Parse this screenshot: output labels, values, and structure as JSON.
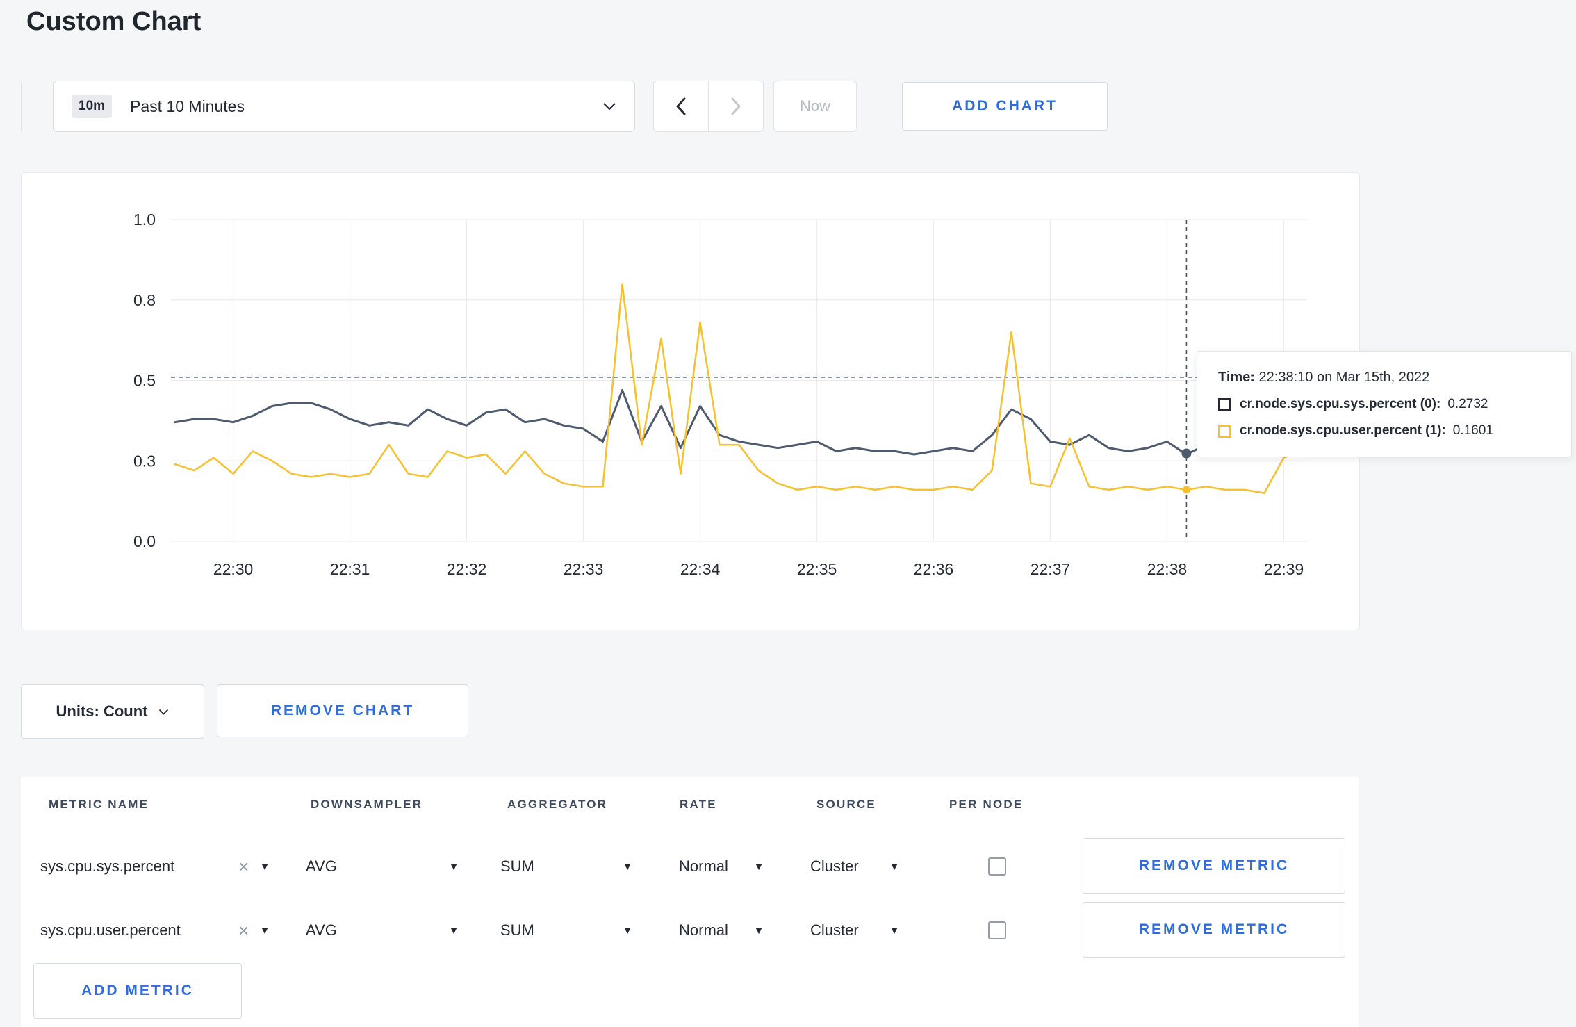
{
  "page": {
    "title": "Custom Chart"
  },
  "icons": {
    "caret_down": "▼",
    "close": "×"
  },
  "toolbar": {
    "time_range": {
      "badge": "10m",
      "label": "Past 10 Minutes"
    },
    "now_label": "Now",
    "add_chart_label": "ADD CHART"
  },
  "chart_data": {
    "type": "line",
    "title": "",
    "xlabel": "",
    "ylabel": "",
    "grid": true,
    "legend_position": "tooltip",
    "ylim": [
      0,
      1
    ],
    "x_domain": [
      -32,
      552
    ],
    "x_start": -30,
    "x_step": 10,
    "x_ticks": [
      {
        "x": 0,
        "label": "22:30"
      },
      {
        "x": 60,
        "label": "22:31"
      },
      {
        "x": 120,
        "label": "22:32"
      },
      {
        "x": 180,
        "label": "22:33"
      },
      {
        "x": 240,
        "label": "22:34"
      },
      {
        "x": 300,
        "label": "22:35"
      },
      {
        "x": 360,
        "label": "22:36"
      },
      {
        "x": 420,
        "label": "22:37"
      },
      {
        "x": 480,
        "label": "22:38"
      },
      {
        "x": 540,
        "label": "22:39"
      }
    ],
    "y_ticks": [
      {
        "y": 0,
        "label": "0.0"
      },
      {
        "y": 0.25,
        "label": "0.3"
      },
      {
        "y": 0.5,
        "label": "0.5"
      },
      {
        "y": 0.75,
        "label": "0.8"
      },
      {
        "y": 1,
        "label": "1.0"
      }
    ],
    "series": [
      {
        "name": "cr.node.sys.cpu.sys.percent",
        "color": "#4e5a6e",
        "values": [
          0.37,
          0.38,
          0.38,
          0.37,
          0.39,
          0.42,
          0.43,
          0.43,
          0.41,
          0.38,
          0.36,
          0.37,
          0.36,
          0.41,
          0.38,
          0.36,
          0.4,
          0.41,
          0.37,
          0.38,
          0.36,
          0.35,
          0.31,
          0.47,
          0.31,
          0.42,
          0.29,
          0.42,
          0.33,
          0.31,
          0.3,
          0.29,
          0.3,
          0.31,
          0.28,
          0.29,
          0.28,
          0.28,
          0.27,
          0.28,
          0.29,
          0.28,
          0.33,
          0.41,
          0.38,
          0.31,
          0.3,
          0.33,
          0.29,
          0.28,
          0.29,
          0.31,
          0.27,
          0.3,
          0.31,
          0.3,
          0.29,
          0.3,
          0.27
        ]
      },
      {
        "name": "cr.node.sys.cpu.user.percent",
        "color": "#f6c02e",
        "values": [
          0.24,
          0.22,
          0.26,
          0.21,
          0.28,
          0.25,
          0.21,
          0.2,
          0.21,
          0.2,
          0.21,
          0.3,
          0.21,
          0.2,
          0.28,
          0.26,
          0.27,
          0.21,
          0.28,
          0.21,
          0.18,
          0.17,
          0.17,
          0.8,
          0.3,
          0.63,
          0.21,
          0.68,
          0.3,
          0.3,
          0.22,
          0.18,
          0.16,
          0.17,
          0.16,
          0.17,
          0.16,
          0.17,
          0.16,
          0.16,
          0.17,
          0.16,
          0.22,
          0.65,
          0.18,
          0.17,
          0.32,
          0.17,
          0.16,
          0.17,
          0.16,
          0.17,
          0.16,
          0.17,
          0.16,
          0.16,
          0.15,
          0.26,
          0.28
        ]
      }
    ],
    "crosshair": {
      "x": 490,
      "hline_y": 0.51,
      "points": [
        {
          "series": 0,
          "y": 0.2732
        },
        {
          "series": 1,
          "y": 0.1601
        }
      ]
    }
  },
  "tooltip": {
    "time_label": "Time:",
    "time_value": "22:38:10 on Mar 15th, 2022",
    "rows": [
      {
        "name": "cr.node.sys.cpu.sys.percent (0):",
        "value": "0.2732",
        "color": "#242a35"
      },
      {
        "name": "cr.node.sys.cpu.user.percent (1):",
        "value": "0.1601",
        "color": "#f6c02e"
      }
    ]
  },
  "chart_actions": {
    "units_label": "Units: Count",
    "remove_chart_label": "REMOVE CHART"
  },
  "metrics_table": {
    "headers": [
      "METRIC NAME",
      "DOWNSAMPLER",
      "AGGREGATOR",
      "RATE",
      "SOURCE",
      "PER NODE"
    ],
    "rows": [
      {
        "metric": "sys.cpu.sys.percent",
        "downsampler": "AVG",
        "aggregator": "SUM",
        "rate": "Normal",
        "source": "Cluster",
        "per_node_checked": false,
        "remove_label": "REMOVE METRIC"
      },
      {
        "metric": "sys.cpu.user.percent",
        "downsampler": "AVG",
        "aggregator": "SUM",
        "rate": "Normal",
        "source": "Cluster",
        "per_node_checked": false,
        "remove_label": "REMOVE METRIC"
      }
    ],
    "add_metric_label": "ADD METRIC"
  }
}
